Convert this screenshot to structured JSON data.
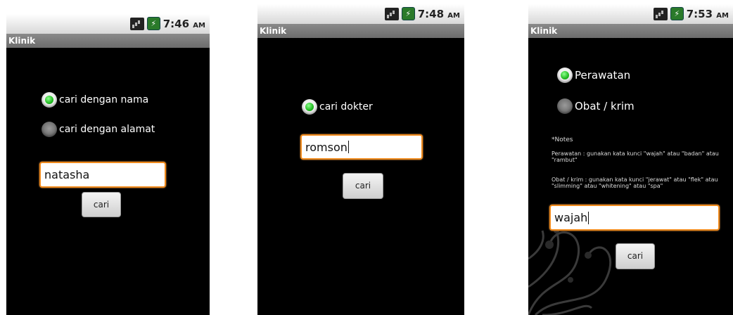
{
  "app_title": "Klinik",
  "screens": [
    {
      "time": "7:46",
      "ampm": "AM",
      "radio": [
        {
          "label": "cari dengan nama",
          "checked": true
        },
        {
          "label": "cari dengan alamat",
          "checked": false
        }
      ],
      "input_value": "natasha",
      "button_label": "cari"
    },
    {
      "time": "7:48",
      "ampm": "AM",
      "radio": [
        {
          "label": "cari dokter",
          "checked": true
        }
      ],
      "input_value": "romson",
      "button_label": "cari"
    },
    {
      "time": "7:53",
      "ampm": "AM",
      "radio": [
        {
          "label": "Perawatan",
          "checked": true
        },
        {
          "label": "Obat / krim",
          "checked": false
        }
      ],
      "notes": {
        "heading": "*Notes",
        "line1": "Perawatan : gunakan kata kunci \"wajah\" atau \"badan\" atau \"rambut\"",
        "line2": "Obat / krim : gunakan kata kunci \"jerawat\" atau \"flek\" atau \"slimming\" atau \"whitening\" atau \"spa\""
      },
      "input_value": "wajah",
      "button_label": "cari"
    }
  ],
  "icons": {
    "signal": "signal-icon",
    "battery": "battery-icon"
  },
  "colors": {
    "accent": "#f08a1c",
    "radio_checked": "#22bb22",
    "titlebar": "#777777"
  }
}
